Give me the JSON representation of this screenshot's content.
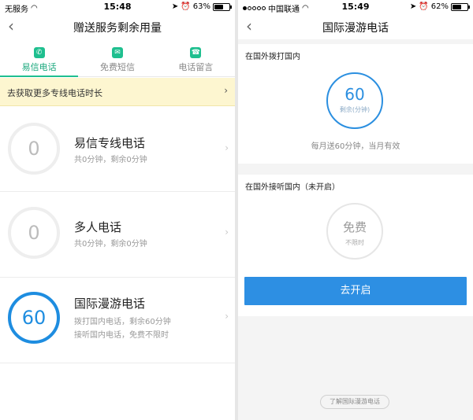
{
  "left": {
    "status": {
      "carrier": "无服务",
      "time": "15:48",
      "battery": "63%",
      "battery_level": 0.63
    },
    "nav": {
      "back": "‹",
      "title": "赠送服务剩余用量"
    },
    "tabs": [
      {
        "icon": "✆",
        "label": "易信电话",
        "active": true
      },
      {
        "icon": "✉",
        "label": "免费短信",
        "active": false
      },
      {
        "icon": "☎",
        "label": "电话留言",
        "active": false
      }
    ],
    "banner": {
      "text": "去获取更多专线电话时长",
      "arrow": "›"
    },
    "rows": [
      {
        "value": "0",
        "title": "易信专线电话",
        "sub1": "共0分钟，剩余0分钟",
        "sub2": ""
      },
      {
        "value": "0",
        "title": "多人电话",
        "sub1": "共0分钟，剩余0分钟",
        "sub2": ""
      },
      {
        "value": "60",
        "title": "国际漫游电话",
        "sub1": "拨打国内电话，剩余60分钟",
        "sub2": "接听国内电话，免费不限时"
      }
    ]
  },
  "right": {
    "status": {
      "carrier": "中国联通",
      "time": "15:49",
      "battery": "62%",
      "battery_level": 0.62
    },
    "nav": {
      "back": "‹",
      "title": "国际漫游电话"
    },
    "outgoing": {
      "title": "在国外拨打国内",
      "value": "60",
      "unit": "剩余(分钟)",
      "note": "每月送60分钟，当月有效"
    },
    "incoming": {
      "title": "在国外接听国内（未开启）",
      "value": "免费",
      "unit": "不限时"
    },
    "open_button": "去开启",
    "learn_button": "了解国际漫游电话"
  },
  "colors": {
    "accent_green": "#1fbf8f",
    "accent_blue": "#2d8fe3",
    "banner_bg": "#fdf6d0"
  }
}
